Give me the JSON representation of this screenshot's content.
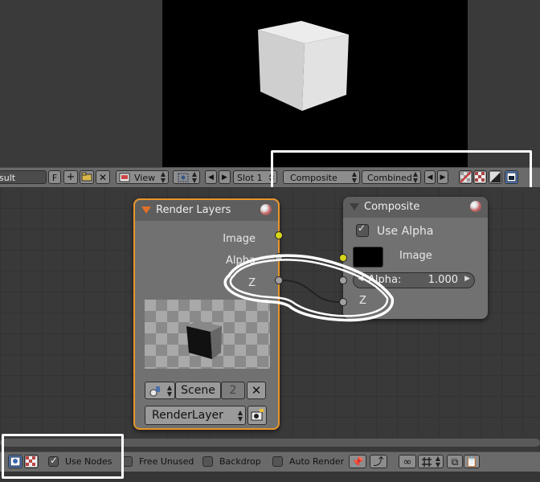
{
  "image_editor_header": {
    "image_name": "sult",
    "fake_user": "F",
    "view_menu": "View",
    "slot": "Slot 1",
    "layer_select": "Composite",
    "pass_select": "Combined"
  },
  "render_layers_node": {
    "title": "Render Layers",
    "outputs": [
      "Image",
      "Alpha",
      "Z"
    ],
    "scene_label": "Scene",
    "scene_users": "2",
    "layer_select": "RenderLayer"
  },
  "composite_node": {
    "title": "Composite",
    "use_alpha_label": "Use Alpha",
    "use_alpha_checked": true,
    "inputs": [
      "Image",
      "Z"
    ],
    "alpha_field_label": "Alpha:",
    "alpha_value": "1.000"
  },
  "node_editor_header": {
    "use_nodes": "Use Nodes",
    "free_unused": "Free Unused",
    "backdrop": "Backdrop",
    "auto_render": "Auto Render"
  },
  "colors": {
    "socket_image": "#d8d61a",
    "socket_value": "#a0a0a0",
    "node_selected_outline": "#e8952a",
    "highlight": "#ffffff"
  }
}
